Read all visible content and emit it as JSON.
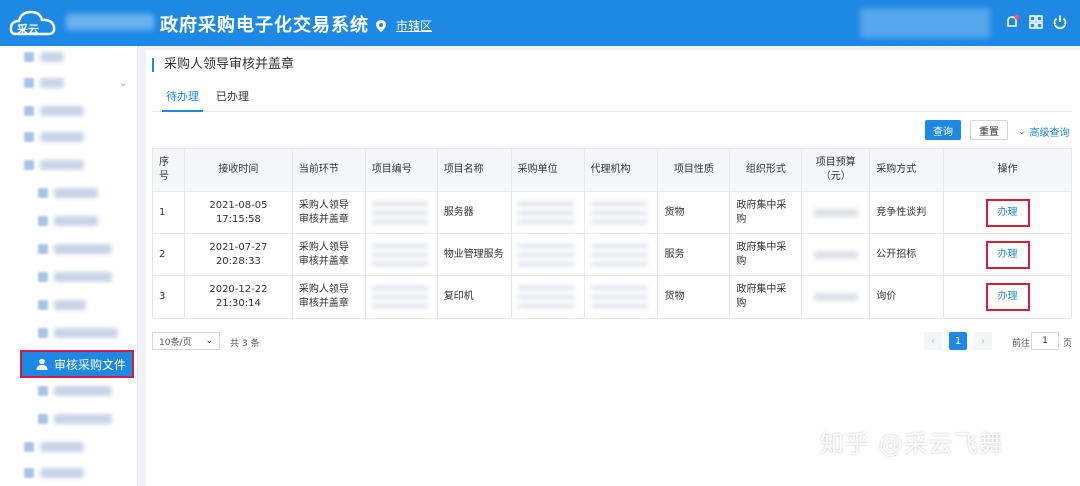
{
  "header": {
    "app_title": "政府采购电子化交易系统",
    "region": "市辖区"
  },
  "sidebar": {
    "active_item": "审核采购文件"
  },
  "page": {
    "title": "采购人领导审核并盖章",
    "tabs": [
      "待办理",
      "已办理"
    ]
  },
  "toolbar": {
    "query_label": "查询",
    "reset_label": "重置",
    "advanced_label": "高级查询"
  },
  "table": {
    "columns": [
      "序号",
      "接收时间",
      "当前环节",
      "项目编号",
      "项目名称",
      "采购单位",
      "代理机构",
      "项目性质",
      "组织形式",
      "项目预算\n（元）",
      "采购方式",
      "操作"
    ],
    "rows": [
      {
        "no": "1",
        "time": "2021-08-05 17:15:58",
        "step": "采购人领导审核并盖章",
        "name": "服务器",
        "nature": "货物",
        "form": "政府集中采购",
        "method": "竞争性谈判",
        "action": "办理"
      },
      {
        "no": "2",
        "time": "2021-07-27 20:28:33",
        "step": "采购人领导审核并盖章",
        "name": "物业管理服务",
        "nature": "服务",
        "form": "政府集中采购",
        "method": "公开招标",
        "action": "办理"
      },
      {
        "no": "3",
        "time": "2020-12-22 21:30:14",
        "step": "采购人领导审核并盖章",
        "name": "复印机",
        "nature": "货物",
        "form": "政府集中采购",
        "method": "询价",
        "action": "办理"
      }
    ]
  },
  "pagination": {
    "page_size": "10条/页",
    "total": "共 3 条",
    "current": "1",
    "goto_label": "前往",
    "goto_value": "1",
    "goto_unit": "页"
  },
  "watermark": "知乎 @采云飞舞",
  "colors": {
    "primary": "#1e88e5",
    "highlight": "#d81b3c"
  }
}
